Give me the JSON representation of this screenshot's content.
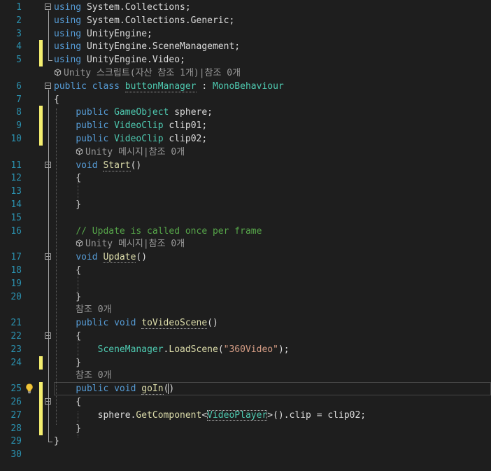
{
  "theme": {
    "background": "#1e1e1e",
    "line_number": "#2b91af",
    "keyword": "#569cd6",
    "type": "#4ec9b0",
    "text": "#dcdcdc",
    "comment": "#57a64a",
    "string": "#d69d85",
    "method": "#dcdcaa",
    "reference_lens": "#999999",
    "modified_bar": "#f5ef6f"
  },
  "lines": [
    {
      "num": "1",
      "tokens": [
        {
          "t": "using",
          "c": "kw"
        },
        {
          "t": " System.Collections;",
          "c": "txt"
        }
      ]
    },
    {
      "num": "2",
      "tokens": [
        {
          "t": "using",
          "c": "kw"
        },
        {
          "t": " System.Collections.Generic;",
          "c": "txt"
        }
      ]
    },
    {
      "num": "3",
      "tokens": [
        {
          "t": "using",
          "c": "kw"
        },
        {
          "t": " UnityEngine;",
          "c": "txt"
        }
      ]
    },
    {
      "num": "4",
      "tokens": [
        {
          "t": "using",
          "c": "kw"
        },
        {
          "t": " UnityEngine.SceneManagement;",
          "c": "txt"
        }
      ]
    },
    {
      "num": "5",
      "tokens": [
        {
          "t": "using",
          "c": "kw"
        },
        {
          "t": " UnityEngine.Video;",
          "c": "txt"
        }
      ]
    },
    {
      "num": "",
      "lens": "Unity 스크립트(자산 참조 1개)|참조 0개"
    },
    {
      "num": "6",
      "tokens": [
        {
          "t": "public",
          "c": "kw"
        },
        {
          "t": " ",
          "c": "txt"
        },
        {
          "t": "class",
          "c": "kw"
        },
        {
          "t": " ",
          "c": "txt"
        },
        {
          "t": "buttonManager",
          "c": "type",
          "sq": true
        },
        {
          "t": " : ",
          "c": "txt"
        },
        {
          "t": "MonoBehaviour",
          "c": "type"
        }
      ]
    },
    {
      "num": "7",
      "tokens": [
        {
          "t": "{",
          "c": "txt"
        }
      ]
    },
    {
      "num": "8",
      "tokens": [
        {
          "t": "    ",
          "c": "txt"
        },
        {
          "t": "public",
          "c": "kw"
        },
        {
          "t": " ",
          "c": "txt"
        },
        {
          "t": "GameObject",
          "c": "type"
        },
        {
          "t": " sphere;",
          "c": "txt"
        }
      ]
    },
    {
      "num": "9",
      "tokens": [
        {
          "t": "    ",
          "c": "txt"
        },
        {
          "t": "public",
          "c": "kw"
        },
        {
          "t": " ",
          "c": "txt"
        },
        {
          "t": "VideoClip",
          "c": "type"
        },
        {
          "t": " clip01;",
          "c": "txt"
        }
      ]
    },
    {
      "num": "10",
      "tokens": [
        {
          "t": "    ",
          "c": "txt"
        },
        {
          "t": "public",
          "c": "kw"
        },
        {
          "t": " ",
          "c": "txt"
        },
        {
          "t": "VideoClip",
          "c": "type"
        },
        {
          "t": " clip02;",
          "c": "txt"
        }
      ]
    },
    {
      "num": "",
      "lens": "Unity 메시지|참조 0개",
      "indent": 1
    },
    {
      "num": "11",
      "tokens": [
        {
          "t": "    ",
          "c": "txt"
        },
        {
          "t": "void",
          "c": "kw"
        },
        {
          "t": " ",
          "c": "txt"
        },
        {
          "t": "Start",
          "c": "method",
          "sq": true
        },
        {
          "t": "()",
          "c": "txt"
        }
      ]
    },
    {
      "num": "12",
      "tokens": [
        {
          "t": "    {",
          "c": "txt"
        }
      ]
    },
    {
      "num": "13",
      "tokens": []
    },
    {
      "num": "14",
      "tokens": [
        {
          "t": "    }",
          "c": "txt"
        }
      ]
    },
    {
      "num": "15",
      "tokens": []
    },
    {
      "num": "16",
      "tokens": [
        {
          "t": "    ",
          "c": "txt"
        },
        {
          "t": "// Update is called once per frame",
          "c": "cmt"
        }
      ]
    },
    {
      "num": "",
      "lens": "Unity 메시지|참조 0개",
      "indent": 1
    },
    {
      "num": "17",
      "tokens": [
        {
          "t": "    ",
          "c": "txt"
        },
        {
          "t": "void",
          "c": "kw"
        },
        {
          "t": " ",
          "c": "txt"
        },
        {
          "t": "Update",
          "c": "method",
          "sq": true
        },
        {
          "t": "()",
          "c": "txt"
        }
      ]
    },
    {
      "num": "18",
      "tokens": [
        {
          "t": "    {",
          "c": "txt"
        }
      ]
    },
    {
      "num": "19",
      "tokens": []
    },
    {
      "num": "20",
      "tokens": [
        {
          "t": "    }",
          "c": "txt"
        }
      ]
    },
    {
      "num": "",
      "lens": "참조 0개",
      "indent": 1,
      "nocube": true
    },
    {
      "num": "21",
      "tokens": [
        {
          "t": "    ",
          "c": "txt"
        },
        {
          "t": "public",
          "c": "kw"
        },
        {
          "t": " ",
          "c": "txt"
        },
        {
          "t": "void",
          "c": "kw"
        },
        {
          "t": " ",
          "c": "txt"
        },
        {
          "t": "toVideoScene",
          "c": "method",
          "sq": true
        },
        {
          "t": "()",
          "c": "txt"
        }
      ]
    },
    {
      "num": "22",
      "tokens": [
        {
          "t": "    {",
          "c": "txt"
        }
      ]
    },
    {
      "num": "23",
      "tokens": [
        {
          "t": "        ",
          "c": "txt"
        },
        {
          "t": "SceneManager",
          "c": "type"
        },
        {
          "t": ".",
          "c": "txt"
        },
        {
          "t": "LoadScene",
          "c": "method"
        },
        {
          "t": "(",
          "c": "txt"
        },
        {
          "t": "\"360Video\"",
          "c": "str"
        },
        {
          "t": ");",
          "c": "txt"
        }
      ]
    },
    {
      "num": "24",
      "tokens": [
        {
          "t": "    }",
          "c": "txt"
        }
      ]
    },
    {
      "num": "",
      "lens": "참조 0개",
      "indent": 1,
      "nocube": true
    },
    {
      "num": "25",
      "tokens": [
        {
          "t": "    ",
          "c": "txt"
        },
        {
          "t": "public",
          "c": "kw"
        },
        {
          "t": " ",
          "c": "txt"
        },
        {
          "t": "void",
          "c": "kw"
        },
        {
          "t": " ",
          "c": "txt"
        },
        {
          "t": "goIn",
          "c": "method",
          "sq": true
        },
        {
          "t": "()",
          "c": "txt"
        }
      ]
    },
    {
      "num": "26",
      "tokens": [
        {
          "t": "    {",
          "c": "txt"
        }
      ]
    },
    {
      "num": "27",
      "tokens": [
        {
          "t": "        sphere.",
          "c": "txt"
        },
        {
          "t": "GetComponent",
          "c": "method"
        },
        {
          "t": "<",
          "c": "txt"
        },
        {
          "t": "VideoPlayer",
          "c": "type",
          "box": true
        },
        {
          "t": ">().clip = clip02;",
          "c": "txt"
        }
      ]
    },
    {
      "num": "28",
      "tokens": [
        {
          "t": "    }",
          "c": "txt"
        }
      ]
    },
    {
      "num": "29",
      "tokens": [
        {
          "t": "}",
          "c": "txt"
        }
      ]
    },
    {
      "num": "30",
      "tokens": []
    }
  ]
}
